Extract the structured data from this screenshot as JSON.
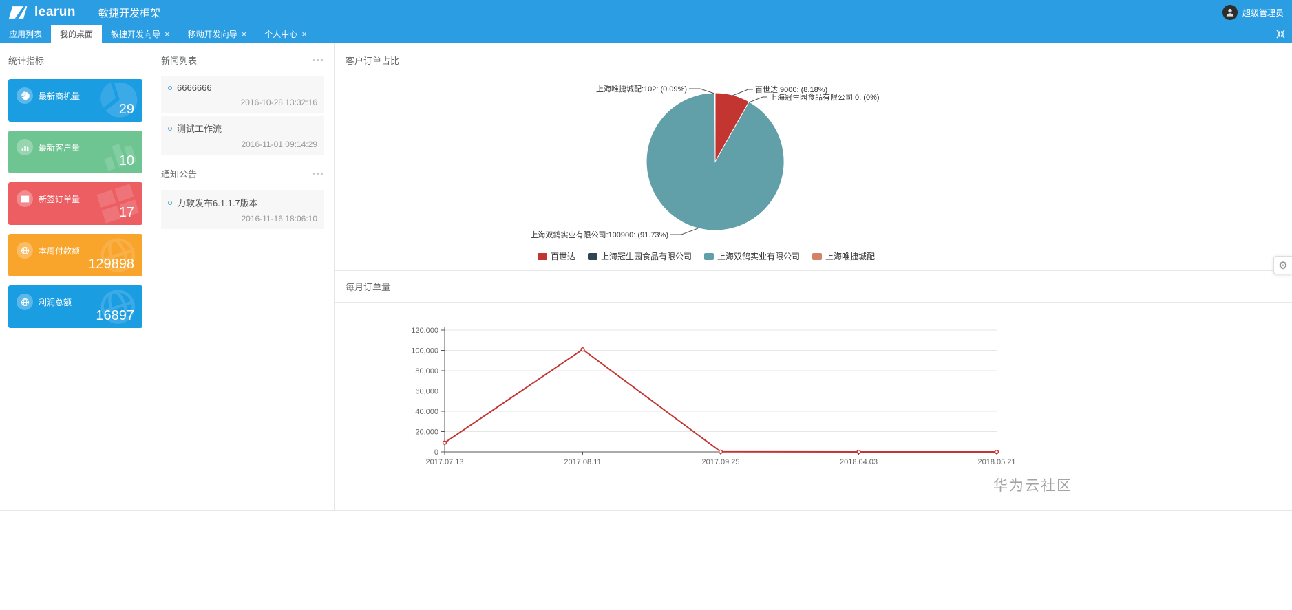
{
  "header": {
    "logo_text": "learun",
    "divider": "｜",
    "app_title": "敏捷开发框架",
    "user_name": "超级管理员"
  },
  "tabs": [
    {
      "label": "应用列表",
      "closable": false,
      "active": false
    },
    {
      "label": "我的桌面",
      "closable": false,
      "active": true
    },
    {
      "label": "敏捷开发向导",
      "closable": true,
      "active": false
    },
    {
      "label": "移动开发向导",
      "closable": true,
      "active": false
    },
    {
      "label": "个人中心",
      "closable": true,
      "active": false
    }
  ],
  "stats": {
    "section_title": "统计指标",
    "cards": [
      {
        "label": "最新商机量",
        "value": "29",
        "color": "#1b9de2",
        "icon": "pie-chart-icon"
      },
      {
        "label": "最新客户量",
        "value": "10",
        "color": "#6ec592",
        "icon": "bar-chart-icon"
      },
      {
        "label": "新签订单量",
        "value": "17",
        "color": "#ed5e63",
        "icon": "windows-icon"
      },
      {
        "label": "本周付款额",
        "value": "129898",
        "color": "#f9a42b",
        "icon": "globe-icon"
      },
      {
        "label": "利润总额",
        "value": "16897",
        "color": "#1b9de2",
        "icon": "globe-icon"
      }
    ]
  },
  "news": {
    "section_title": "新闻列表",
    "items": [
      {
        "title": "6666666",
        "time": "2016-10-28 13:32:16"
      },
      {
        "title": "测试工作流",
        "time": "2016-11-01 09:14:29"
      }
    ]
  },
  "notice": {
    "section_title": "通知公告",
    "items": [
      {
        "title": "力软发布6.1.1.7版本",
        "time": "2016-11-16 18:06:10"
      }
    ]
  },
  "watermark": "华为云社区",
  "colors": {
    "brand_blue": "#2b9de2",
    "line_red": "#c23531",
    "pie_palette": [
      "#c23531",
      "#2f4554",
      "#61a0a8",
      "#d48265"
    ]
  },
  "chart_data": [
    {
      "type": "pie",
      "title": "客户订单占比",
      "series": [
        {
          "name": "百世达",
          "value": 9000,
          "percent": "8.18%",
          "color": "#c23531",
          "label": "百世达:9000: (8.18%)"
        },
        {
          "name": "上海冠生园食品有限公司",
          "value": 0,
          "percent": "0%",
          "color": "#2f4554",
          "label": "上海冠生园食品有限公司:0: (0%)"
        },
        {
          "name": "上海双鸽实业有限公司",
          "value": 100900,
          "percent": "91.73%",
          "color": "#61a0a8",
          "label": "上海双鸽实业有限公司:100900: (91.73%)"
        },
        {
          "name": "上海唯捷城配",
          "value": 102,
          "percent": "0.09%",
          "color": "#d48265",
          "label": "上海唯捷城配:102: (0.09%)"
        }
      ],
      "legend": [
        "百世达",
        "上海冠生园食品有限公司",
        "上海双鸽实业有限公司",
        "上海唯捷城配"
      ],
      "legend_position": "bottom"
    },
    {
      "type": "line",
      "title": "每月订单量",
      "categories": [
        "2017.07.13",
        "2017.08.11",
        "2017.09.25",
        "2018.04.03",
        "2018.05.21"
      ],
      "values": [
        9000,
        100900,
        102,
        0,
        0
      ],
      "ylim": [
        0,
        120000
      ],
      "ytick_labels": [
        "0",
        "20,000",
        "40,000",
        "60,000",
        "80,000",
        "100,000",
        "120,000"
      ],
      "line_color": "#c23531",
      "grid": true
    }
  ]
}
